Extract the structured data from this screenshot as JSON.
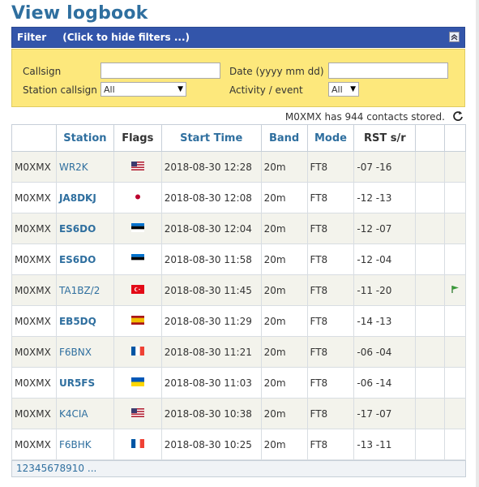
{
  "page_title": "View logbook",
  "filter": {
    "label": "Filter",
    "toggle_text": "(Click to hide filters ...)",
    "callsign_label": "Callsign",
    "callsign_value": "",
    "date_label": "Date (yyyy mm dd)",
    "date_value": "",
    "station_callsign_label": "Station callsign",
    "station_callsign_value": "All",
    "activity_label": "Activity / event",
    "activity_value": "All"
  },
  "contacts_text": "M0XMX has 944 contacts stored.",
  "columns": [
    "",
    "Station",
    "Flags",
    "Start Time",
    "Band",
    "Mode",
    "RST s/r",
    "",
    ""
  ],
  "rows": [
    {
      "op": "M0XMX",
      "station": "WR2K",
      "bold": false,
      "flag": "us",
      "time": "2018-08-30 12:28",
      "band": "20m",
      "mode": "FT8",
      "rst": "-07 -16",
      "marker": false
    },
    {
      "op": "M0XMX",
      "station": "JA8DKJ",
      "bold": true,
      "flag": "jp",
      "time": "2018-08-30 12:08",
      "band": "20m",
      "mode": "FT8",
      "rst": "-12 -13",
      "marker": false
    },
    {
      "op": "M0XMX",
      "station": "ES6DO",
      "bold": true,
      "flag": "ee",
      "time": "2018-08-30 12:04",
      "band": "20m",
      "mode": "FT8",
      "rst": "-12 -07",
      "marker": false
    },
    {
      "op": "M0XMX",
      "station": "ES6DO",
      "bold": true,
      "flag": "ee",
      "time": "2018-08-30 11:58",
      "band": "20m",
      "mode": "FT8",
      "rst": "-12 -04",
      "marker": false
    },
    {
      "op": "M0XMX",
      "station": "TA1BZ/2",
      "bold": false,
      "flag": "tr",
      "time": "2018-08-30 11:45",
      "band": "20m",
      "mode": "FT8",
      "rst": "-11 -20",
      "marker": true
    },
    {
      "op": "M0XMX",
      "station": "EB5DQ",
      "bold": true,
      "flag": "es",
      "time": "2018-08-30 11:29",
      "band": "20m",
      "mode": "FT8",
      "rst": "-14 -13",
      "marker": false
    },
    {
      "op": "M0XMX",
      "station": "F6BNX",
      "bold": false,
      "flag": "fr",
      "time": "2018-08-30 11:21",
      "band": "20m",
      "mode": "FT8",
      "rst": "-06 -04",
      "marker": false
    },
    {
      "op": "M0XMX",
      "station": "UR5FS",
      "bold": true,
      "flag": "ua",
      "time": "2018-08-30 11:03",
      "band": "20m",
      "mode": "FT8",
      "rst": "-06 -14",
      "marker": false
    },
    {
      "op": "M0XMX",
      "station": "K4CIA",
      "bold": false,
      "flag": "us",
      "time": "2018-08-30 10:38",
      "band": "20m",
      "mode": "FT8",
      "rst": "-17 -07",
      "marker": false
    },
    {
      "op": "M0XMX",
      "station": "F6BHK",
      "bold": false,
      "flag": "fr",
      "time": "2018-08-30 10:25",
      "band": "20m",
      "mode": "FT8",
      "rst": "-13 -11",
      "marker": false
    }
  ],
  "pagination": [
    "1",
    "2",
    "3",
    "4",
    "5",
    "6",
    "7",
    "8",
    "9",
    "10",
    "..."
  ],
  "colors": {
    "accent": "#2f6f9f",
    "filter_bar": "#3355aa",
    "filter_panel": "#fde87c",
    "marker": "#3a9a3a"
  }
}
